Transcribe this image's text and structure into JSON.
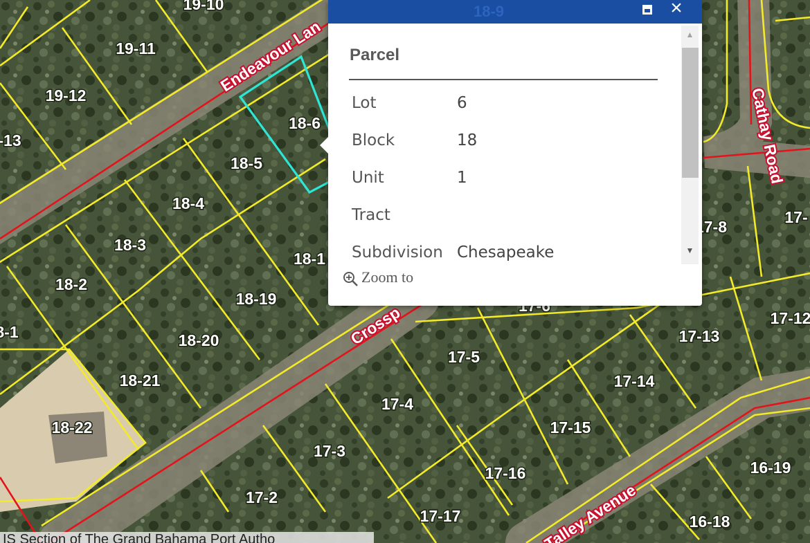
{
  "map": {
    "parcels": [
      "19-10",
      "19-11",
      "19-12",
      "-13",
      "18-6",
      "18-5",
      "18-4",
      "18-3",
      "18-2",
      "8-1",
      "18-1",
      "18-19",
      "18-20",
      "18-21",
      "18-22",
      "18-9",
      "17-8",
      "17-",
      "17-13",
      "17-12",
      "17-6",
      "17-5",
      "17-4",
      "17-3",
      "17-2",
      "17-17",
      "17-16",
      "17-15",
      "17-14",
      "16-19",
      "16-18"
    ],
    "roads": [
      "Endeavour Lan",
      "Crossp",
      "Cathay Road",
      "Talley Avenue"
    ],
    "colors": {
      "parcel_line": "#f3ea2a",
      "road_line": "#e3131b",
      "selected_parcel": "#2ee6d6",
      "popup_header": "#1a4ea3"
    }
  },
  "popup": {
    "header_ghost": "18-9",
    "maximize_icon": "maximize-icon",
    "close_icon": "×",
    "title": "Parcel",
    "fields": [
      {
        "label": "Lot",
        "value": "6"
      },
      {
        "label": "Block",
        "value": "18"
      },
      {
        "label": "Unit",
        "value": "1"
      },
      {
        "label": "Tract",
        "value": ""
      },
      {
        "label": "Subdivision",
        "value": "Chesapeake"
      }
    ],
    "zoom_to": "Zoom to"
  },
  "attribution": "IS Section of The Grand Bahama Port Autho"
}
